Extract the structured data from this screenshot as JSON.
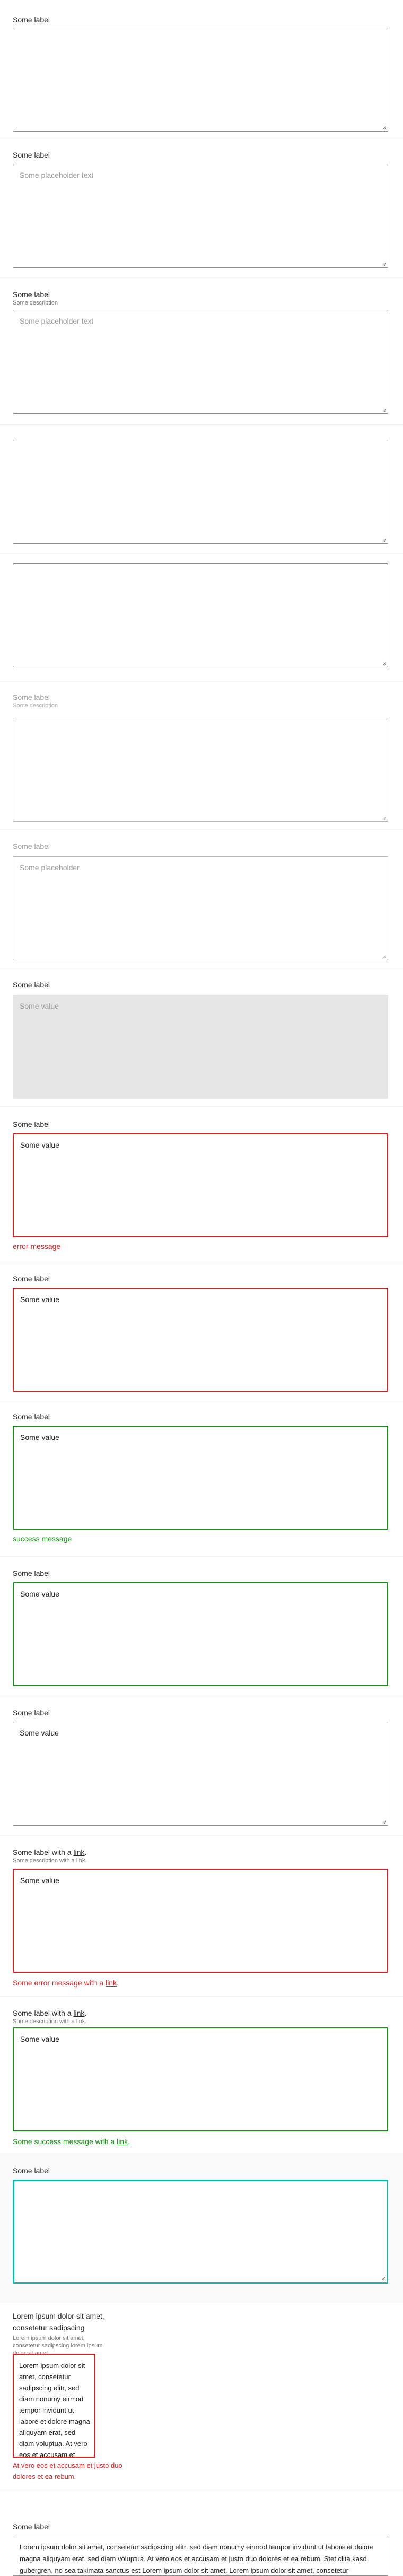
{
  "fields": {
    "f1": {
      "label": "Some label",
      "value": ""
    },
    "f2": {
      "label": "Some label",
      "placeholder": "Some placeholder text"
    },
    "f3": {
      "label": "Some label",
      "description": "Some description",
      "placeholder": "Some placeholder text"
    },
    "f4": {
      "value": ""
    },
    "f5": {
      "value": ""
    },
    "f6": {
      "label": "Some label",
      "description": "Some description",
      "state": "disabled"
    },
    "f7": {
      "label": "Some label",
      "placeholder": "Some placeholder",
      "state": "disabled"
    },
    "f8": {
      "label": "Some label",
      "value": "Some value",
      "state": "readonly"
    },
    "f9": {
      "label": "Some label",
      "value": "Some value",
      "error": "error message"
    },
    "f10": {
      "label": "Some label",
      "value": "Some value",
      "state": "error"
    },
    "f11": {
      "label": "Some label",
      "value": "Some value",
      "success": "success message"
    },
    "f12": {
      "label": "Some label",
      "value": "Some value",
      "state": "success"
    },
    "f13": {
      "label": "Some label",
      "value": "Some value"
    },
    "f14": {
      "label_prefix": "Some label with a ",
      "label_link": "link",
      "label_suffix": ".",
      "desc_prefix": "Some description with a ",
      "desc_link": "link",
      "desc_suffix": ".",
      "value": "Some value",
      "error_prefix": "Some error message with a ",
      "error_link": "link",
      "error_suffix": "."
    },
    "f15": {
      "label_prefix": "Some label with a ",
      "label_link": "link",
      "label_suffix": ".",
      "desc_prefix": "Some description with a ",
      "desc_link": "link",
      "desc_suffix": ".",
      "value": "Some value",
      "success_prefix": "Some success message with a ",
      "success_link": "link",
      "success_suffix": "."
    },
    "f16": {
      "label": "Some label",
      "value": "",
      "state": "focused"
    },
    "f17": {
      "label": "Lorem ipsum dolor sit amet, consetetur sadipscing",
      "description": "Lorem ipsum dolor sit amet, consetetur sadipscing lorem ipsum dolor sit amet",
      "value": "Lorem ipsum dolor sit amet, consetetur sadipscing elitr, sed diam nonumy eirmod tempor invidunt ut labore et dolore magna aliquyam erat, sed diam voluptua. At vero eos et accusam et justo duo dolores et ea rebum. Stet clita kasd gubergren",
      "error": "At vero eos et accusam et justo duo dolores et ea rebum."
    },
    "f18": {
      "label": "Some label",
      "value": "Lorem ipsum dolor sit amet, consetetur sadipscing elitr, sed diam nonumy eirmod tempor invidunt ut labore et dolore magna aliquyam erat, sed diam voluptua. At vero eos et accusam et justo duo dolores et ea rebum. Stet clita kasd gubergren, no sea takimata sanctus est Lorem ipsum dolor sit amet. Lorem ipsum dolor sit amet, consetetur sadipscing elitr, sed diam nonumy eirmod tempor invidunt ut labore et dolore magna aliquyam erat, sed diam voluptua. At vero eos et accusam et justo duo dolores et ea rebum. Stet clita kasd gubergren, no sea takimata sanctus est Lorem ipsum dolor sit amet. Lorem ipsum dolor sit amet, consetetur sadipscing elitr, sed diam nonumy eirmod tempor invidunt ut labore et dolore magna aliquyam erat, sed diam voluptua. At vero eos et accusam et justo duo dolores et ea rebum."
    }
  },
  "colors": {
    "error": "#e02020",
    "success": "#149414",
    "focus": "#1ab4a8",
    "readonly_bg": "#e6e6e6"
  },
  "icons": {
    "resize": "resize-grip-icon"
  }
}
